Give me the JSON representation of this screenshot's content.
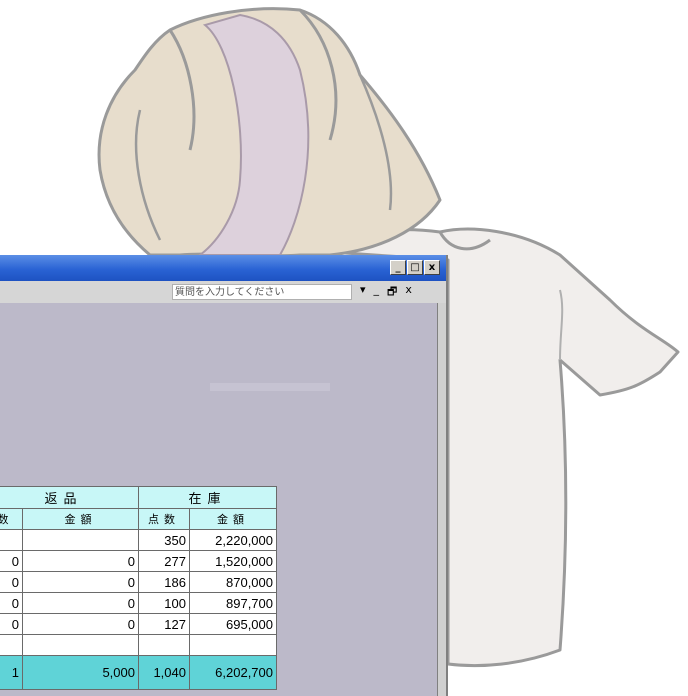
{
  "window": {
    "controls": [
      "_",
      "□",
      "x"
    ],
    "ask_placeholder": "質問を入力してください",
    "ask_dropdown": "▾",
    "doc_controls": [
      "_",
      "🗗",
      "x"
    ]
  },
  "table": {
    "groups": [
      "返品",
      "在庫"
    ],
    "subheaders": [
      "数",
      "金額",
      "点数",
      "金額"
    ],
    "rows": [
      {
        "ret_count": "",
        "ret_amount": "",
        "stock_count": "350",
        "stock_amount": "2,220,000"
      },
      {
        "ret_count": "0",
        "ret_amount": "0",
        "stock_count": "277",
        "stock_amount": "1,520,000"
      },
      {
        "ret_count": "0",
        "ret_amount": "0",
        "stock_count": "186",
        "stock_amount": "870,000"
      },
      {
        "ret_count": "0",
        "ret_amount": "0",
        "stock_count": "100",
        "stock_amount": "897,700"
      },
      {
        "ret_count": "0",
        "ret_amount": "0",
        "stock_count": "127",
        "stock_amount": "695,000"
      }
    ],
    "total": {
      "ret_count": "1",
      "ret_amount": "5,000",
      "stock_count": "1,040",
      "stock_amount": "6,202,700"
    }
  },
  "colors": {
    "titlebar": "#2a63d4",
    "header_bg": "#c8f7f7",
    "total_bg": "#5fd3d7",
    "workspace": "#bcb9c9"
  }
}
